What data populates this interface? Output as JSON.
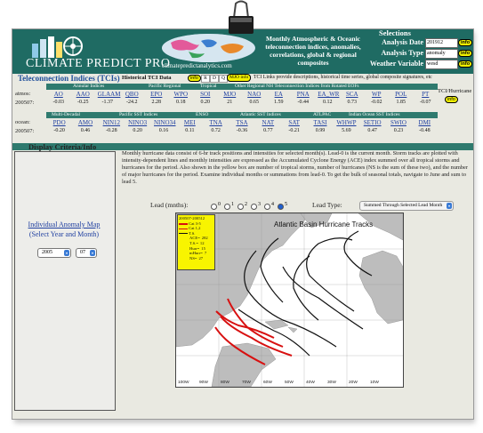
{
  "site": {
    "logo_text": "CLIMATE PREDICT PRO",
    "domain": "climatepredictanalytics.com",
    "tagline": "Monthly Atmospheric & Oceanic teleconnection indices, anomalies, correlations, global & regional composites"
  },
  "selections": {
    "title": "Selections",
    "analysis_date_label": "Analysis Date",
    "analysis_date_value": "201912",
    "analysis_type_label": "Analysis Type",
    "analysis_type_value": "anomaly",
    "weather_variable_label": "Weather Variable",
    "weather_variable_value": "wesd",
    "info_label": "info"
  },
  "tci": {
    "title": "Teleconnection Indices (TCIs)",
    "historical_label": "Historical TCI Data",
    "info_label": "info",
    "r_label": "R",
    "d_label": "D",
    "q_label": "Q",
    "mjo_label": "MJO info",
    "links_text": "TCI Links provide descriptions, historical time series, global composite signatures, etc",
    "atmos_groups": [
      "Annular Indices",
      "Pacific Regional",
      "Tropical",
      "Other Regional NH Teleconnection Indices from Rotated EOFs"
    ],
    "atmos_label": "atmos:",
    "atmos_date": "200507:",
    "atmos_indices": [
      "AO",
      "AAO",
      "GLAAM",
      "QBO",
      "EPO",
      "WPO",
      "SOI",
      "MJO",
      "NAO",
      "EA",
      "PNA",
      "EA_WR",
      "SCA",
      "WP",
      "POL",
      "PT"
    ],
    "atmos_values": [
      "-0.03",
      "-0.25",
      "-1.37",
      "-24.2",
      "2.28",
      "0.18",
      "0.20",
      "21",
      "0.65",
      "1.59",
      "-0.44",
      "0.12",
      "0.73",
      "-0.02",
      "1.85",
      "-0.07"
    ],
    "ocean_groups": [
      "Multi-Decadal",
      "Pacific SST Indices",
      "ENSO",
      "Atlantic SST Indices",
      "ATLPAC",
      "Indian Ocean SST Indices"
    ],
    "ocean_label": "ocean:",
    "ocean_date": "200507:",
    "ocean_indices": [
      "PDO",
      "AMO",
      "NIN12",
      "NINO3",
      "NINO34",
      "MEI",
      "TNA",
      "TSA",
      "NAT",
      "SAT",
      "TASI",
      "WHWP",
      "SETIO",
      "SWIO",
      "DMI"
    ],
    "ocean_values": [
      "-0.20",
      "0.46",
      "-0.28",
      "0.20",
      "0.16",
      "0.11",
      "0.72",
      "-0.36",
      "0.77",
      "-0.21",
      "0.99",
      "5.69",
      "0.47",
      "0.23",
      "-0.48"
    ],
    "hurricane_label": "TCI/Hurricane",
    "hurricane_info": "info"
  },
  "display": {
    "title": "Display Criteria/Info",
    "individual_map_link": "Individual Anomaly Map",
    "individual_map_sub": "(Select Year and Month)",
    "year_value": "2005",
    "month_value": "07",
    "description": "Monthly hurricane data consist of 6-hr track positions and intensities for selected month(s). Lead-0 is the current month. Storm tracks are plotted with intensity-dependent lines and monthly intensities are expressed as the Accumulated Cyclone Energy (ACE) index summed over all tropical storms and hurricanes for the period. Also shown in the yellow box are number of tropical storms, number of hurricanes (NS is the sum of these two), and the number of major hurricanes for the period. Examine individual months or summations from lead-0. To get the bulk of seasonal totals, navigate to June and sum to lead 5.",
    "lead_label": "Lead (mnths):",
    "lead_options": [
      "0",
      "1",
      "2",
      "3",
      "4",
      "5"
    ],
    "lead_selected": "5",
    "lead_type_label": "Lead Type:",
    "lead_type_value": "Summed Through Selected Lead Month"
  },
  "map": {
    "title": "Atlantic Basin Hurricane Tracks",
    "legend_period": "200507-200512",
    "legend_items": [
      "Cat 3-5",
      "Cat 1,2",
      "T.S."
    ],
    "stats": [
      {
        "label": "ACE=",
        "value": "282"
      },
      {
        "label": "T.S.=",
        "value": "12"
      },
      {
        "label": "Hurr=",
        "value": "15"
      },
      {
        "label": "mHurr=",
        "value": "7"
      },
      {
        "label": "NS=",
        "value": "27"
      }
    ],
    "lon_labels": [
      "100W",
      "90W",
      "80W",
      "70W",
      "60W",
      "50W",
      "40W",
      "30W",
      "20W",
      "10W"
    ],
    "colors": {
      "cat35": "#d81010",
      "cat12": "#d81010",
      "ts": "#111111",
      "land": "#bdbdbd"
    }
  }
}
